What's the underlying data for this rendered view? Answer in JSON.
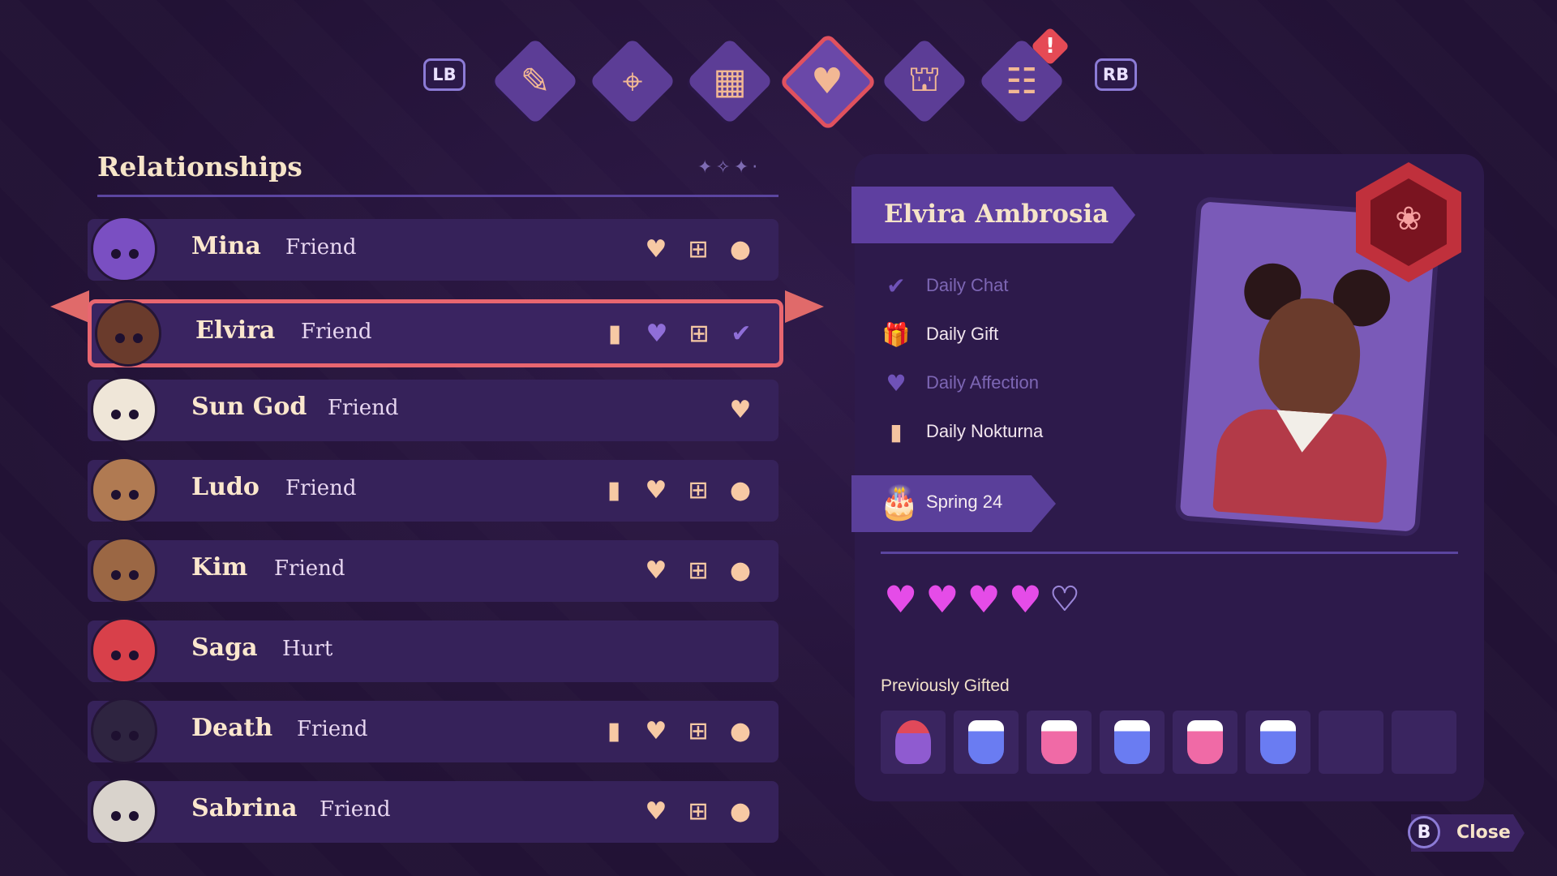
{
  "tabbar": {
    "lb_label": "LB",
    "rb_label": "RB",
    "tabs": [
      {
        "icon": "quill-icon",
        "glyph": "✎",
        "active": false,
        "alert": false
      },
      {
        "icon": "map-icon",
        "glyph": "⌖",
        "active": false,
        "alert": false
      },
      {
        "icon": "calendar-icon",
        "glyph": "▦",
        "active": false,
        "alert": false
      },
      {
        "icon": "heart-icon",
        "glyph": "♥",
        "active": true,
        "alert": false
      },
      {
        "icon": "tombstone-icon",
        "glyph": "⛫",
        "active": false,
        "alert": false
      },
      {
        "icon": "journal-icon",
        "glyph": "☷",
        "active": false,
        "alert": true
      }
    ],
    "alert_mark": "!"
  },
  "relationships": {
    "title": "Relationships",
    "rows": [
      {
        "name": "Mina",
        "status": "Friend",
        "avatar_color": "#7a4fc2",
        "icons": [
          "heart",
          "gift",
          "chat"
        ],
        "done": []
      },
      {
        "name": "Elvira",
        "status": "Friend",
        "avatar_color": "#6a3b2c",
        "icons": [
          "nokturna",
          "heart",
          "gift",
          "chat"
        ],
        "done": [
          "heart",
          "chat"
        ],
        "selected": true
      },
      {
        "name": "Sun God",
        "status": "Friend",
        "avatar_color": "#efe6d8",
        "icons": [
          "heart"
        ],
        "done": []
      },
      {
        "name": "Ludo",
        "status": "Friend",
        "avatar_color": "#b07a52",
        "icons": [
          "nokturna",
          "heart",
          "gift",
          "chat"
        ],
        "done": []
      },
      {
        "name": "Kim",
        "status": "Friend",
        "avatar_color": "#9b6744",
        "icons": [
          "heart",
          "gift",
          "chat"
        ],
        "done": []
      },
      {
        "name": "Saga",
        "status": "Hurt",
        "avatar_color": "#d8404a",
        "icons": [],
        "done": []
      },
      {
        "name": "Death",
        "status": "Friend",
        "avatar_color": "#2e2440",
        "icons": [
          "nokturna",
          "heart",
          "gift",
          "chat"
        ],
        "done": []
      },
      {
        "name": "Sabrina",
        "status": "Friend",
        "avatar_color": "#d9d3cc",
        "icons": [
          "heart",
          "gift",
          "chat"
        ],
        "done": []
      }
    ]
  },
  "detail": {
    "full_name": "Elvira Ambrosia",
    "dailies": [
      {
        "label": "Daily Chat",
        "icon": "chat-check-icon",
        "glyph": "✔",
        "done": true
      },
      {
        "label": "Daily Gift",
        "icon": "gift-icon",
        "glyph": "🎁",
        "done": false
      },
      {
        "label": "Daily Affection",
        "icon": "heart-check-icon",
        "glyph": "♥",
        "done": true
      },
      {
        "label": "Daily Nokturna",
        "icon": "tombstone-icon",
        "glyph": "▮",
        "done": false
      }
    ],
    "birthday": "Spring 24",
    "birthday_icon": "cake-icon",
    "hearts_filled": 4,
    "hearts_total": 5,
    "previously_gifted_title": "Previously Gifted",
    "gifts": [
      "cupcake",
      "blue milkshake",
      "pink milkshake",
      "blue milkshake",
      "pink milkshake",
      "blue milkshake",
      "",
      ""
    ]
  },
  "colors": {
    "accent": "#e54ce8",
    "selected_border": "#e86670",
    "panel": "#2d1a4b",
    "row": "#36225a"
  },
  "close": {
    "button": "B",
    "label": "Close"
  }
}
